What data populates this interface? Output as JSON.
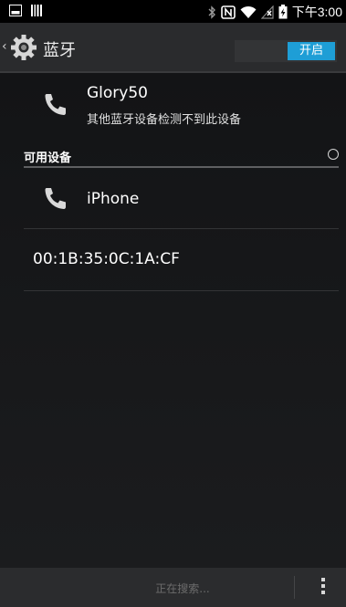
{
  "status_bar": {
    "time": "下午3:00",
    "icons": [
      "screenshot-icon",
      "barcode-icon",
      "bluetooth-icon",
      "nfc-icon",
      "wifi-icon",
      "no-signal-icon",
      "battery-charging-icon"
    ]
  },
  "action_bar": {
    "back_glyph": "‹",
    "title": "蓝牙",
    "toggle_label": "开启",
    "toggle_state": "on"
  },
  "own_device": {
    "name": "Glory50",
    "status": "其他蓝牙设备检测不到此设备"
  },
  "available": {
    "header": "可用设备",
    "devices": [
      {
        "name": "iPhone",
        "icon": "phone-icon"
      },
      {
        "name": "00:1B:35:0C:1A:CF",
        "icon": ""
      }
    ]
  },
  "bottom_bar": {
    "status": "正在搜索...",
    "menu_icon": "overflow-menu-icon"
  },
  "colors": {
    "accent": "#1e9ed6",
    "background": "#000000",
    "action_bar": "#2a2b2d"
  }
}
